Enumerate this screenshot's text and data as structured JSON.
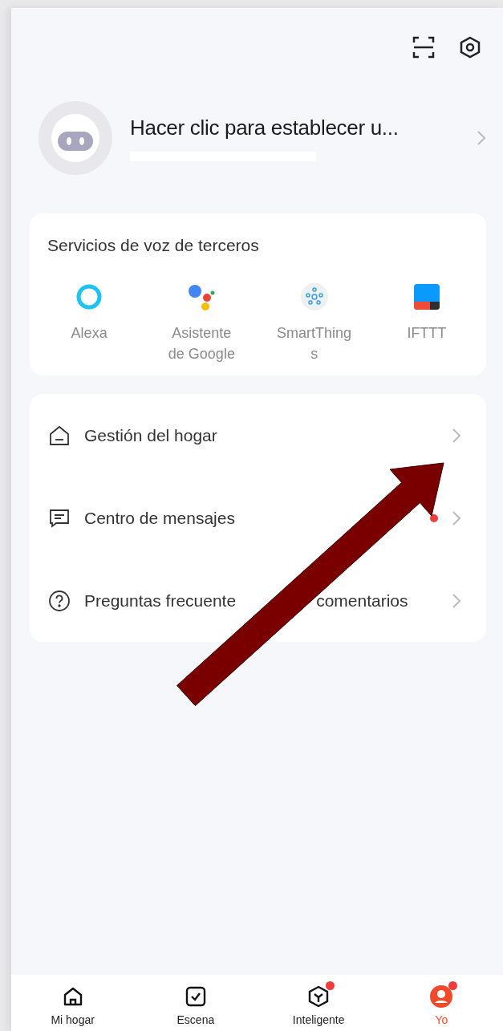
{
  "profile": {
    "name": "Hacer clic para establecer u..."
  },
  "voice_services": {
    "title": "Servicios de voz de terceros",
    "items": [
      {
        "kind": "alexa",
        "label": "Alexa"
      },
      {
        "kind": "google",
        "label": "Asistente de Google"
      },
      {
        "kind": "smartthings",
        "label": "SmartThing s"
      },
      {
        "kind": "ifttt",
        "label": "IFTTT"
      }
    ]
  },
  "menu": [
    {
      "kind": "home",
      "label": "Gestión del hogar",
      "dot": false
    },
    {
      "kind": "message",
      "label": "Centro de mensajes",
      "dot": true
    },
    {
      "kind": "help",
      "label": "Preguntas frecuente",
      "label_tail": "comentarios",
      "dot": false
    }
  ],
  "bottom_nav": [
    {
      "kind": "home",
      "label": "Mi hogar",
      "selected": false,
      "badge": false
    },
    {
      "kind": "scene",
      "label": "Escena",
      "selected": false,
      "badge": false
    },
    {
      "kind": "smart",
      "label": "Inteligente",
      "selected": false,
      "badge": true
    },
    {
      "kind": "me",
      "label": "Yo",
      "selected": true,
      "badge": true
    }
  ]
}
